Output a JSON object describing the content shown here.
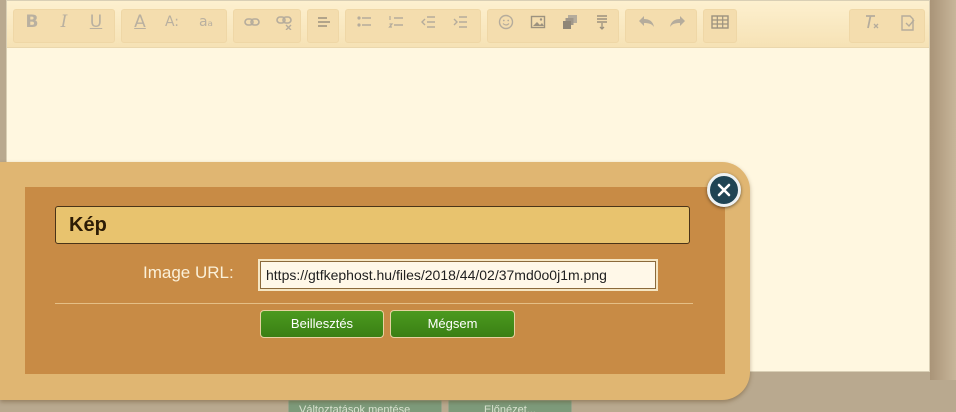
{
  "toolbar": {
    "buttons": [
      {
        "name": "bold-button",
        "label": "B"
      },
      {
        "name": "italic-button",
        "label": "I"
      },
      {
        "name": "underline-button",
        "label": "U"
      },
      {
        "name": "font-color-button",
        "label": "A"
      },
      {
        "name": "font-size-button",
        "label": "A:"
      },
      {
        "name": "font-case-button",
        "label": "aₐ"
      }
    ]
  },
  "dialog": {
    "title": "Kép",
    "url_label": "Image URL:",
    "url_value": "https://gtfkephost.hu/files/2018/44/02/37md0o0j1m.png",
    "insert_label": "Beillesztés",
    "cancel_label": "Mégsem"
  },
  "form_buttons": {
    "save_label": "Változtatások mentése",
    "preview_label": "Előnézet..."
  },
  "colors": {
    "dialog_frame": "#e0b672",
    "dialog_body": "#c88b45",
    "accent_green": "#3f8a17",
    "close_button": "#1f4454"
  }
}
